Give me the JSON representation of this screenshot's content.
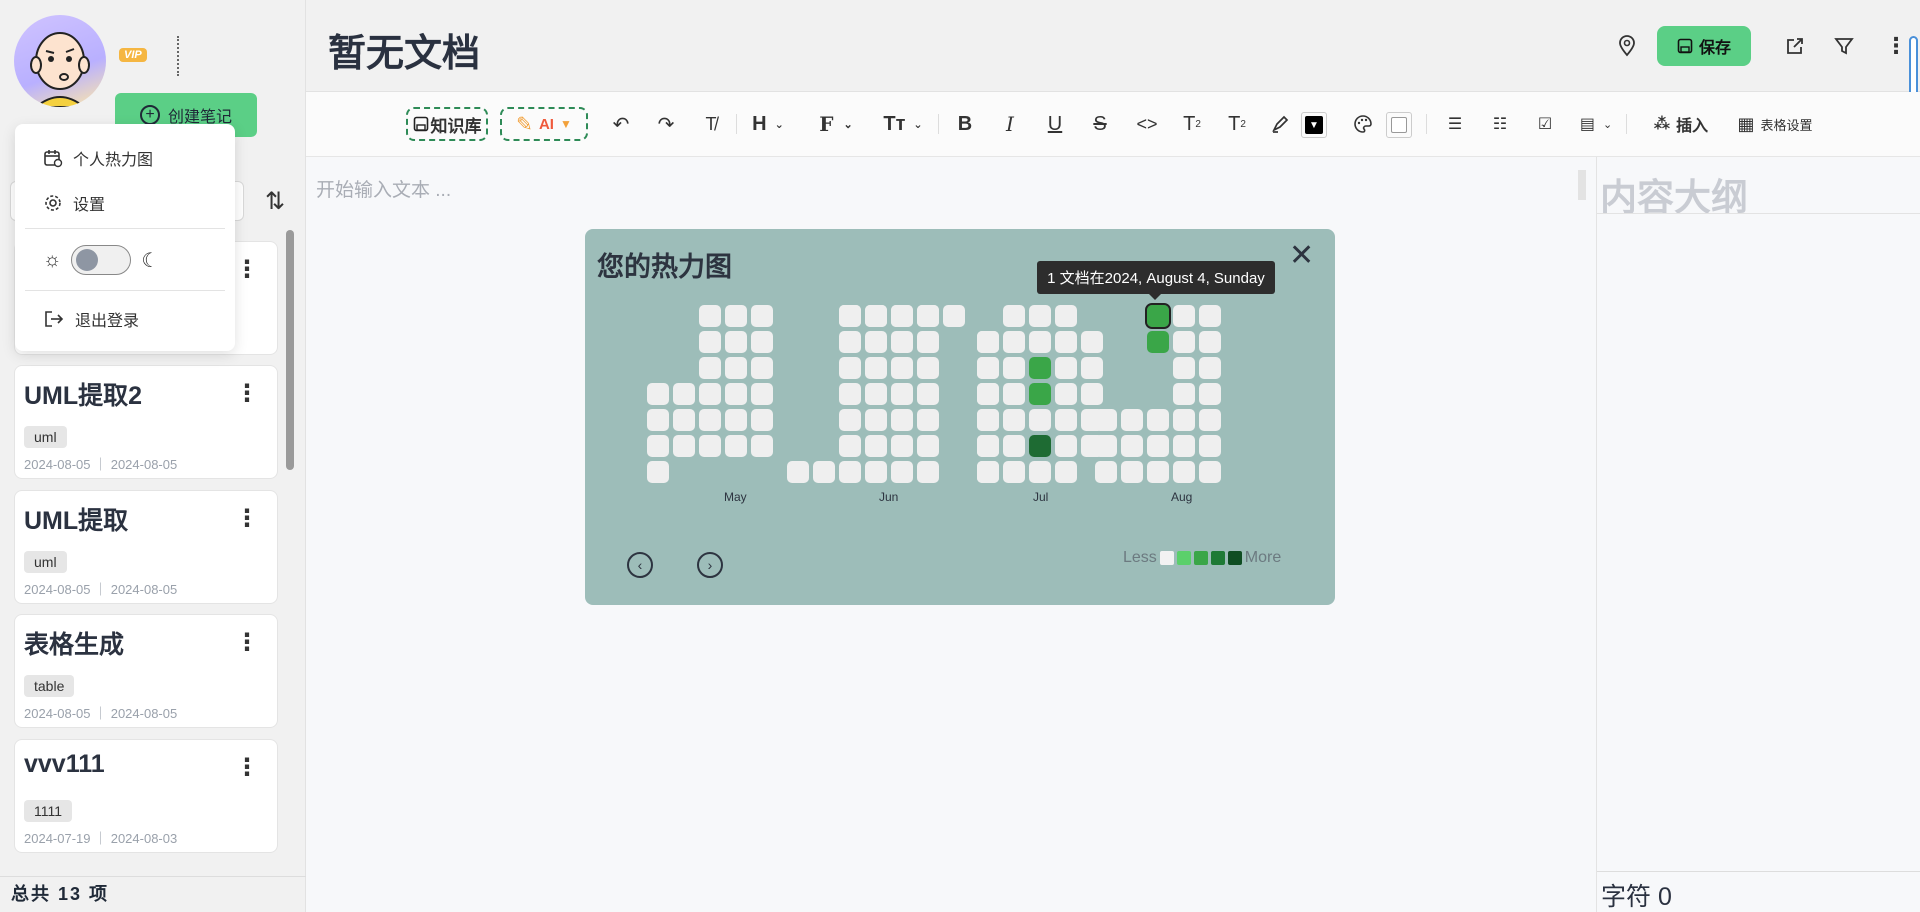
{
  "sidebar": {
    "vip_label": "VIP",
    "create_label": "创建笔记",
    "menu": {
      "heatmap_label": "个人热力图",
      "settings_label": "设置",
      "logout_label": "退出登录"
    },
    "notes": [
      {
        "title": "UML提取2",
        "tag": "uml",
        "dates": "2024-08-05 ｜ 2024-08-05"
      },
      {
        "title": "UML提取",
        "tag": "uml",
        "dates": "2024-08-05 ｜ 2024-08-05"
      },
      {
        "title": "表格生成",
        "tag": "table",
        "dates": "2024-08-05 ｜ 2024-08-05"
      },
      {
        "title": "vvv111",
        "tag": "1111",
        "dates": "2024-07-19 ｜ 2024-08-03"
      }
    ],
    "total_label": "总共 13 项"
  },
  "header": {
    "title": "暂无文档",
    "save_label": "保存"
  },
  "toolbar": {
    "knowledge_label": "知识库",
    "ai_label": "AI",
    "insert_label": "插入",
    "table_settings_label": "表格设置"
  },
  "editor": {
    "placeholder": "开始输入文本 ..."
  },
  "outline": {
    "title": "内容大纲",
    "char_count": "字符 0"
  },
  "heatmap": {
    "title": "您的热力图",
    "tooltip": "1 文档在2024, August 4, Sunday",
    "months": [
      "May",
      "Jun",
      "Jul",
      "Aug"
    ],
    "legend_less": "Less",
    "legend_more": "More",
    "legend_colors": [
      "#f2f2f2",
      "#5bd06b",
      "#3aa648",
      "#1e7a35",
      "#0f4d22"
    ],
    "colors": {
      "empty": "#efefef",
      "l1": "#3aa648",
      "l3": "#1e6b33"
    }
  }
}
